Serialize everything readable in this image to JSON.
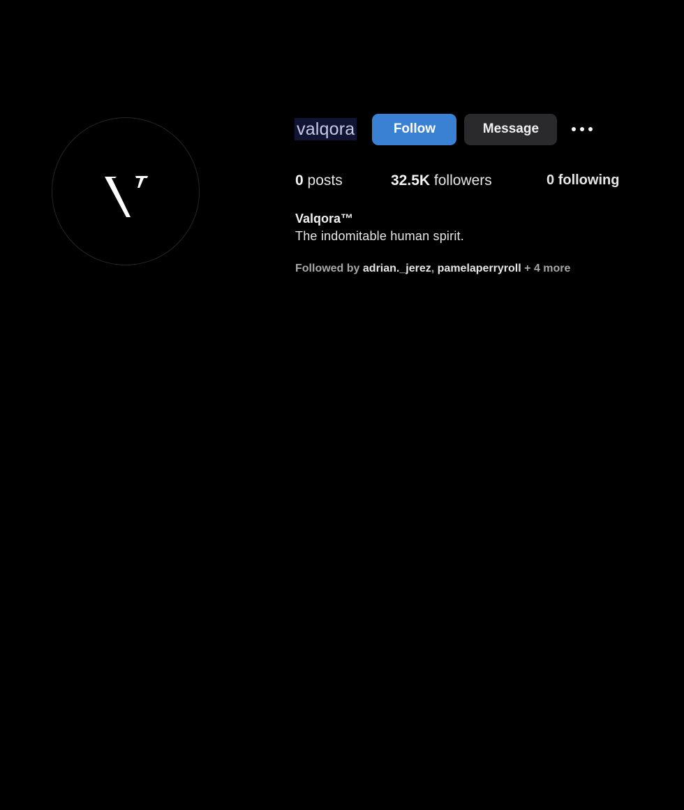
{
  "profile": {
    "username": "valqora",
    "full_name": "Valqora™",
    "bio": "The indomitable human spirit.",
    "avatar_icon": "v-logo-icon"
  },
  "actions": {
    "follow_label": "Follow",
    "message_label": "Message",
    "more_icon": "ellipsis-icon"
  },
  "stats": {
    "posts_count": "0",
    "posts_label": "posts",
    "followers_count": "32.5K",
    "followers_label": "followers",
    "following_count": "0",
    "following_label": "following"
  },
  "followed_by": {
    "prefix": "Followed by",
    "users": [
      "adrian._jerez",
      "pamelaperryroll"
    ],
    "separator": ",",
    "more_text": "+ 4 more"
  },
  "colors": {
    "background": "#000000",
    "follow_button": "#3a80d3",
    "message_button": "#2a2a2c",
    "username_highlight": "#111432"
  }
}
